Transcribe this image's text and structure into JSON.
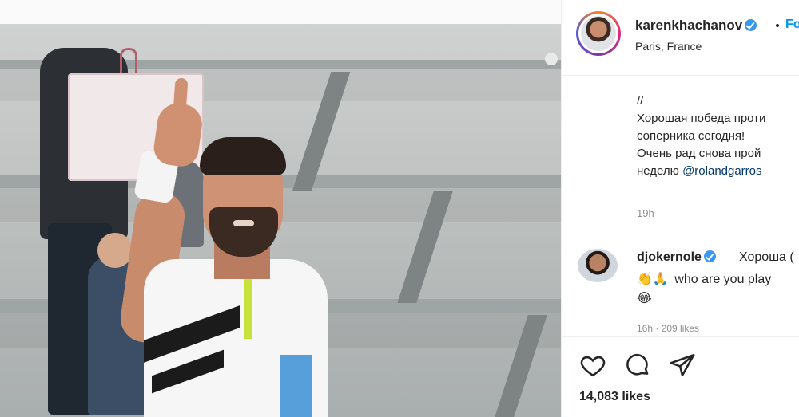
{
  "post": {
    "username": "karenkhachanov",
    "follow_label": "Fo",
    "location": "Paris, France"
  },
  "caption": {
    "lines": [
      "//",
      "Хорошая победа проти",
      "соперника сегодня!",
      "Очень рад снова прой",
      "неделю "
    ],
    "mention": "@rolandgarros",
    "time": "19h"
  },
  "comment": {
    "username": "djokernole",
    "text_line1": "Хороша (",
    "emoji_line2": [
      "clapping-hands",
      "folded-hands"
    ],
    "emoji_line2_glyphs": "👏🙏",
    "text_line2": "who are you play",
    "emoji_line3_glyph": "😂",
    "meta": "16h · 209 likes"
  },
  "actions": {
    "icons": [
      "heart-icon",
      "comment-icon",
      "share-icon"
    ],
    "likes": "14,083 likes"
  },
  "colors": {
    "link_blue": "#0095f6",
    "verified_blue": "#3897f0",
    "mention": "#00376b",
    "muted": "#8e8e8e"
  }
}
